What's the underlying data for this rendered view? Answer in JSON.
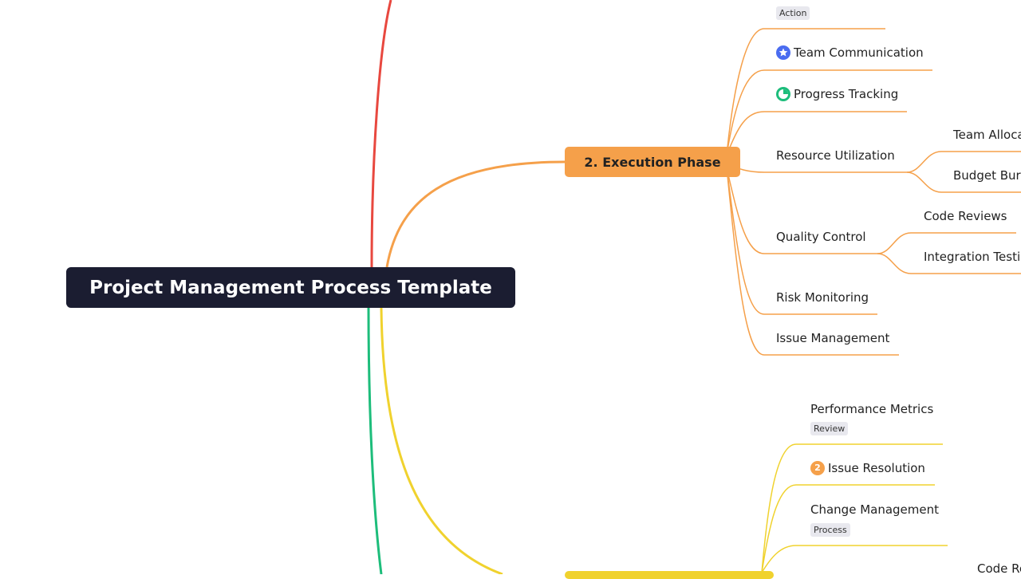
{
  "root": {
    "title": "Project Management Process Template"
  },
  "phases": {
    "execution": {
      "label": "2. Execution Phase",
      "color": "#f5a04a"
    },
    "monitoring": {
      "label": "",
      "color": "#f0d22e"
    }
  },
  "branch_colors": {
    "red": "#e8483f",
    "orange": "#f5a04a",
    "yellow": "#f0d22e",
    "green": "#1dbd7b"
  },
  "execution_children": {
    "top_tag": "Action",
    "team_communication": {
      "label": "Team Communication",
      "icon": "star-badge-icon",
      "icon_color": "#4a6cf0"
    },
    "progress_tracking": {
      "label": "Progress Tracking",
      "icon": "pie-progress-icon",
      "icon_color": "#1dbd7b"
    },
    "resource_utilization": {
      "label": "Resource Utilization",
      "children": [
        "Team Alloca",
        "Budget Bur"
      ]
    },
    "quality_control": {
      "label": "Quality Control",
      "children": [
        "Code Reviews",
        "Integration Testi"
      ]
    },
    "risk_monitoring": {
      "label": "Risk Monitoring"
    },
    "issue_management": {
      "label": "Issue Management"
    }
  },
  "monitoring_children": {
    "performance_metrics": {
      "label": "Performance Metrics",
      "tag": "Review"
    },
    "issue_resolution": {
      "label": "Issue Resolution",
      "icon": "priority-2-icon",
      "icon_text": "2",
      "icon_color": "#f5a04a"
    },
    "change_management": {
      "label": "Change Management",
      "tag": "Process"
    },
    "bottom_cut": "Code Re"
  }
}
